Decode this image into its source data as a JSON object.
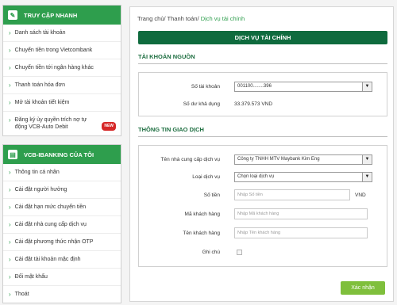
{
  "sidebar": {
    "quick_access": {
      "title": "TRUY CẬP NHANH",
      "items": [
        {
          "label": "Danh sách tài khoản"
        },
        {
          "label": "Chuyển tiền trong Vietcombank"
        },
        {
          "label": "Chuyển tiền tới ngân hàng khác"
        },
        {
          "label": "Thanh toán hóa đơn"
        },
        {
          "label": "Mở tài khoản tiết kiệm"
        },
        {
          "label": "Đăng ký ủy quyền trích nợ tự động VCB-Auto Debit",
          "badge": "NEW"
        }
      ]
    },
    "my_banking": {
      "title": "VCB-IBANKING CỦA TÔI",
      "items": [
        {
          "label": "Thông tin cá nhân"
        },
        {
          "label": "Cài đặt người hưởng"
        },
        {
          "label": "Cài đặt hạn mức chuyển tiền"
        },
        {
          "label": "Cài đặt nhà cung cấp dịch vụ"
        },
        {
          "label": "Cài đặt phương thức nhận OTP"
        },
        {
          "label": "Cài đặt tài khoản mặc định"
        },
        {
          "label": "Đổi mật khẩu"
        },
        {
          "label": "Thoát"
        }
      ]
    }
  },
  "breadcrumb": {
    "home": "Trang chủ",
    "sep1": "/",
    "payment": "Thanh toán",
    "sep2": "/",
    "current": "Dịch vụ tài chính"
  },
  "page_title": "DỊCH VỤ TÀI CHÍNH",
  "source_account": {
    "section_title": "TÀI KHOẢN NGUỒN",
    "account_label": "Số tài khoản",
    "account_value": "001100........396",
    "balance_label": "Số dư khả dụng",
    "balance_value": "33.379.573 VND"
  },
  "transaction": {
    "section_title": "THÔNG TIN GIAO DỊCH",
    "provider_label": "Tên nhà cung cấp dịch vụ",
    "provider_value": "Công ty TNHH MTV Maybank Kim Eng",
    "service_type_label": "Loại dịch vụ",
    "service_type_value": "Chọn loại dịch vụ",
    "amount_label": "Số tiền",
    "amount_placeholder": "Nhập Số tiền",
    "amount_unit": "VND",
    "customer_code_label": "Mã khách hàng",
    "customer_code_placeholder": "Nhập Mã khách hàng",
    "customer_name_label": "Tên khách hàng",
    "customer_name_placeholder": "Nhập Tên khách hàng",
    "note_label": "Ghi chú"
  },
  "submit_label": "Xác nhận",
  "colors": {
    "brand_green": "#2e9e4d",
    "title_bar": "#0f6b3e",
    "submit": "#7fbf3c",
    "badge": "#d62828"
  }
}
